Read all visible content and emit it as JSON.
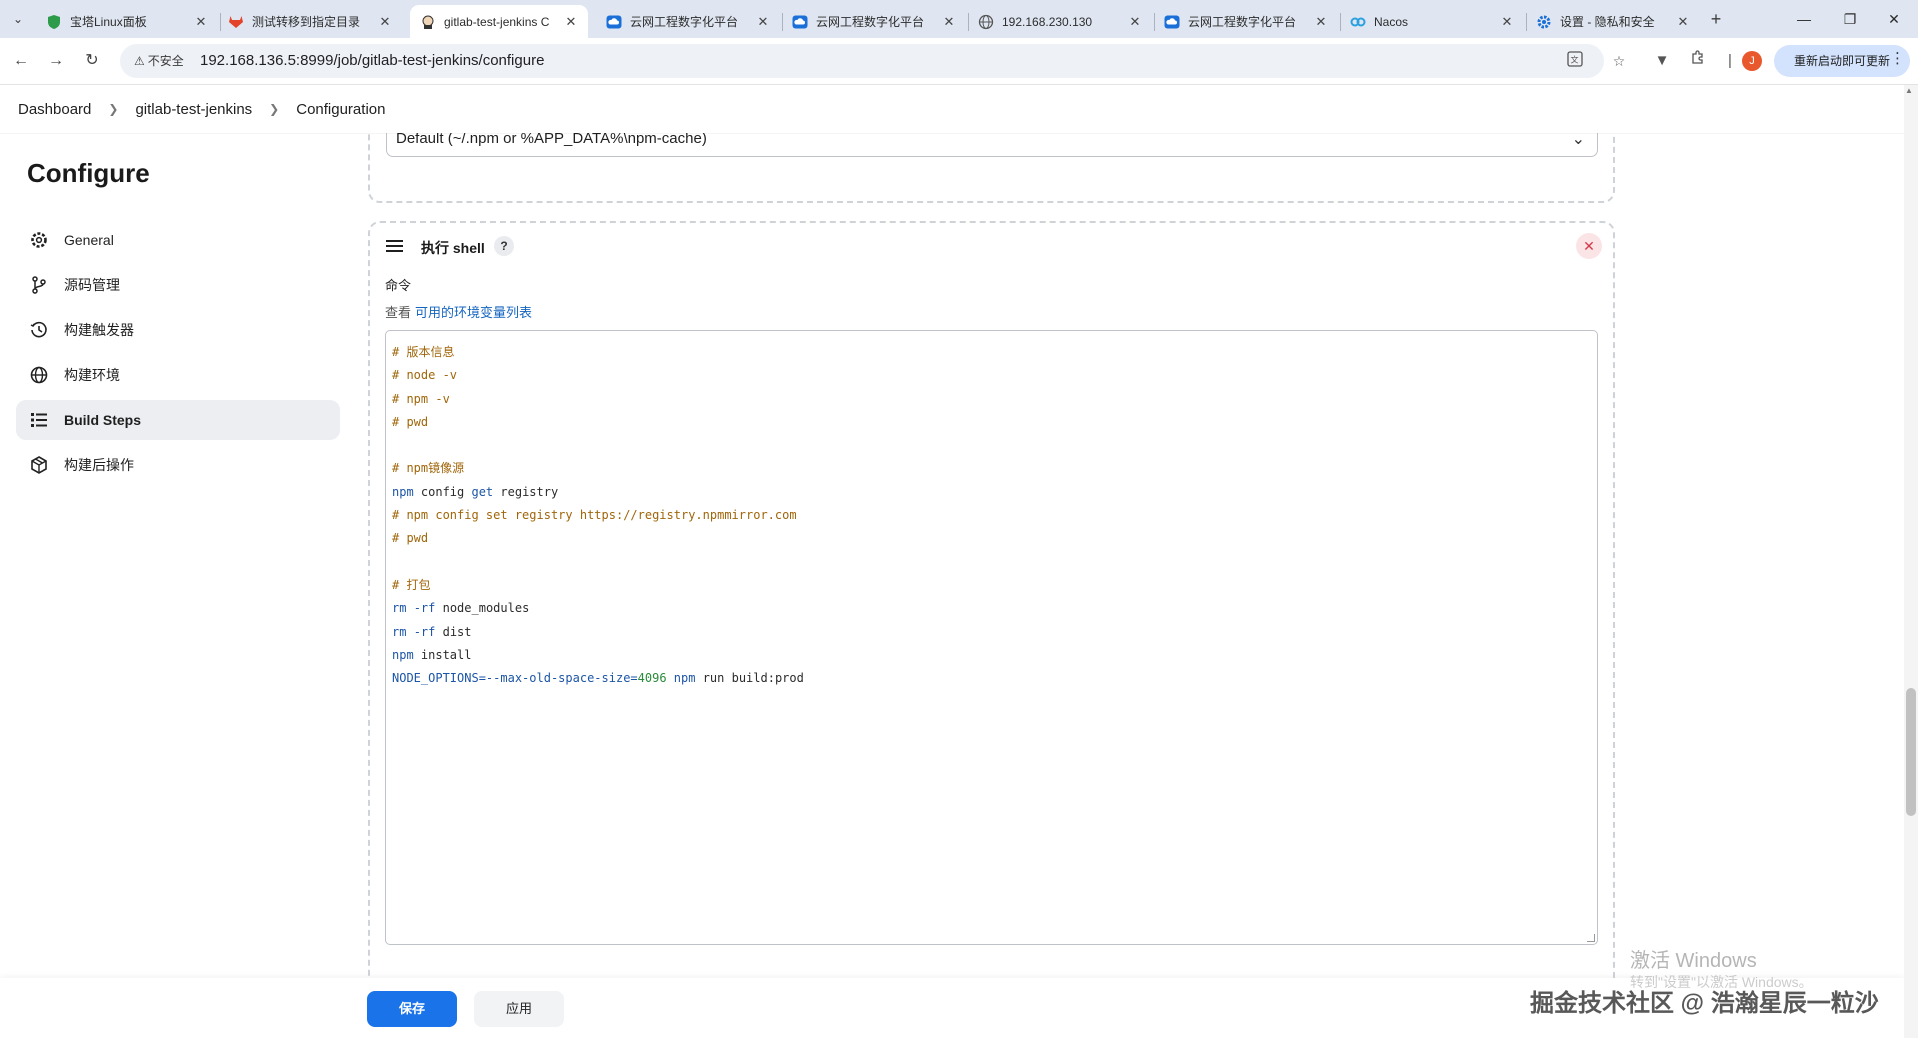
{
  "browser": {
    "tabs": [
      {
        "title": "宝塔Linux面板",
        "icon": "shield-icon",
        "active": false
      },
      {
        "title": "测试转移到指定目录",
        "icon": "gitlab-icon",
        "active": false
      },
      {
        "title": "gitlab-test-jenkins C",
        "icon": "jenkins-icon",
        "active": true
      },
      {
        "title": "云网工程数字化平台",
        "icon": "cloud-icon",
        "active": false
      },
      {
        "title": "云网工程数字化平台",
        "icon": "cloud-icon",
        "active": false
      },
      {
        "title": "192.168.230.130",
        "icon": "globe-icon",
        "active": false
      },
      {
        "title": "云网工程数字化平台",
        "icon": "cloud-icon",
        "active": false
      },
      {
        "title": "Nacos",
        "icon": "nacos-icon",
        "active": false
      },
      {
        "title": "设置 - 隐私和安全",
        "icon": "gear-icon",
        "active": false
      }
    ],
    "security_label": "不安全",
    "url": "192.168.136.5:8999/job/gitlab-test-jenkins/configure",
    "profile_initial": "J",
    "relaunch_label": "重新启动即可更新"
  },
  "breadcrumb": [
    "Dashboard",
    "gitlab-test-jenkins",
    "Configuration"
  ],
  "sidebar": {
    "title": "Configure",
    "items": [
      {
        "label": "General",
        "icon": "gear-icon",
        "active": false
      },
      {
        "label": "源码管理",
        "icon": "branch-icon",
        "active": false
      },
      {
        "label": "构建触发器",
        "icon": "clock-icon",
        "active": false
      },
      {
        "label": "构建环境",
        "icon": "globe-icon",
        "active": false
      },
      {
        "label": "Build Steps",
        "icon": "list-icon",
        "active": true
      },
      {
        "label": "构建后操作",
        "icon": "package-icon",
        "active": false
      }
    ]
  },
  "npm_cache": {
    "selected": "Default (~/.npm or %APP_DATA%\\npm-cache)"
  },
  "shell_step": {
    "title": "执行 shell",
    "help": "?",
    "command_label": "命令",
    "env_prefix": "查看",
    "env_link": "可用的环境变量列表",
    "code_lines": [
      [
        {
          "t": "# 版本信息",
          "k": "comment"
        }
      ],
      [
        {
          "t": "# node -v",
          "k": "comment"
        }
      ],
      [
        {
          "t": "# npm -v",
          "k": "comment"
        }
      ],
      [
        {
          "t": "# pwd",
          "k": "comment"
        }
      ],
      [],
      [
        {
          "t": "# npm镜像源",
          "k": "comment"
        }
      ],
      [
        {
          "t": "npm",
          "k": "cmd"
        },
        {
          "t": " config ",
          "k": "plain"
        },
        {
          "t": "get",
          "k": "cmd"
        },
        {
          "t": " registry",
          "k": "plain"
        }
      ],
      [
        {
          "t": "# npm config set registry https://registry.npmmirror.com",
          "k": "comment"
        }
      ],
      [
        {
          "t": "# pwd",
          "k": "comment"
        }
      ],
      [],
      [
        {
          "t": "# 打包",
          "k": "comment"
        }
      ],
      [
        {
          "t": "rm",
          "k": "cmd"
        },
        {
          "t": " ",
          "k": "plain"
        },
        {
          "t": "-rf",
          "k": "cmd"
        },
        {
          "t": " node_modules",
          "k": "plain"
        }
      ],
      [
        {
          "t": "rm",
          "k": "cmd"
        },
        {
          "t": " ",
          "k": "plain"
        },
        {
          "t": "-rf",
          "k": "cmd"
        },
        {
          "t": " dist",
          "k": "plain"
        }
      ],
      [
        {
          "t": "npm",
          "k": "cmd"
        },
        {
          "t": " install",
          "k": "plain"
        }
      ],
      [
        {
          "t": "NODE_OPTIONS=--max-old-space-size=",
          "k": "cmd"
        },
        {
          "t": "4096",
          "k": "num"
        },
        {
          "t": " ",
          "k": "plain"
        },
        {
          "t": "npm",
          "k": "cmd"
        },
        {
          "t": " run build:prod",
          "k": "plain"
        }
      ]
    ]
  },
  "actions": {
    "save": "保存",
    "apply": "应用"
  },
  "watermarks": {
    "windows_title": "激活 Windows",
    "windows_sub": "转到\"设置\"以激活 Windows。",
    "juejin": "掘金技术社区 @ 浩瀚星辰一粒沙"
  },
  "colors": {
    "primary": "#1a73e8",
    "link": "#1565c0",
    "comment": "#a0660a",
    "command": "#1c55a6",
    "number": "#2a8a3a",
    "danger": "#d33a4a"
  }
}
